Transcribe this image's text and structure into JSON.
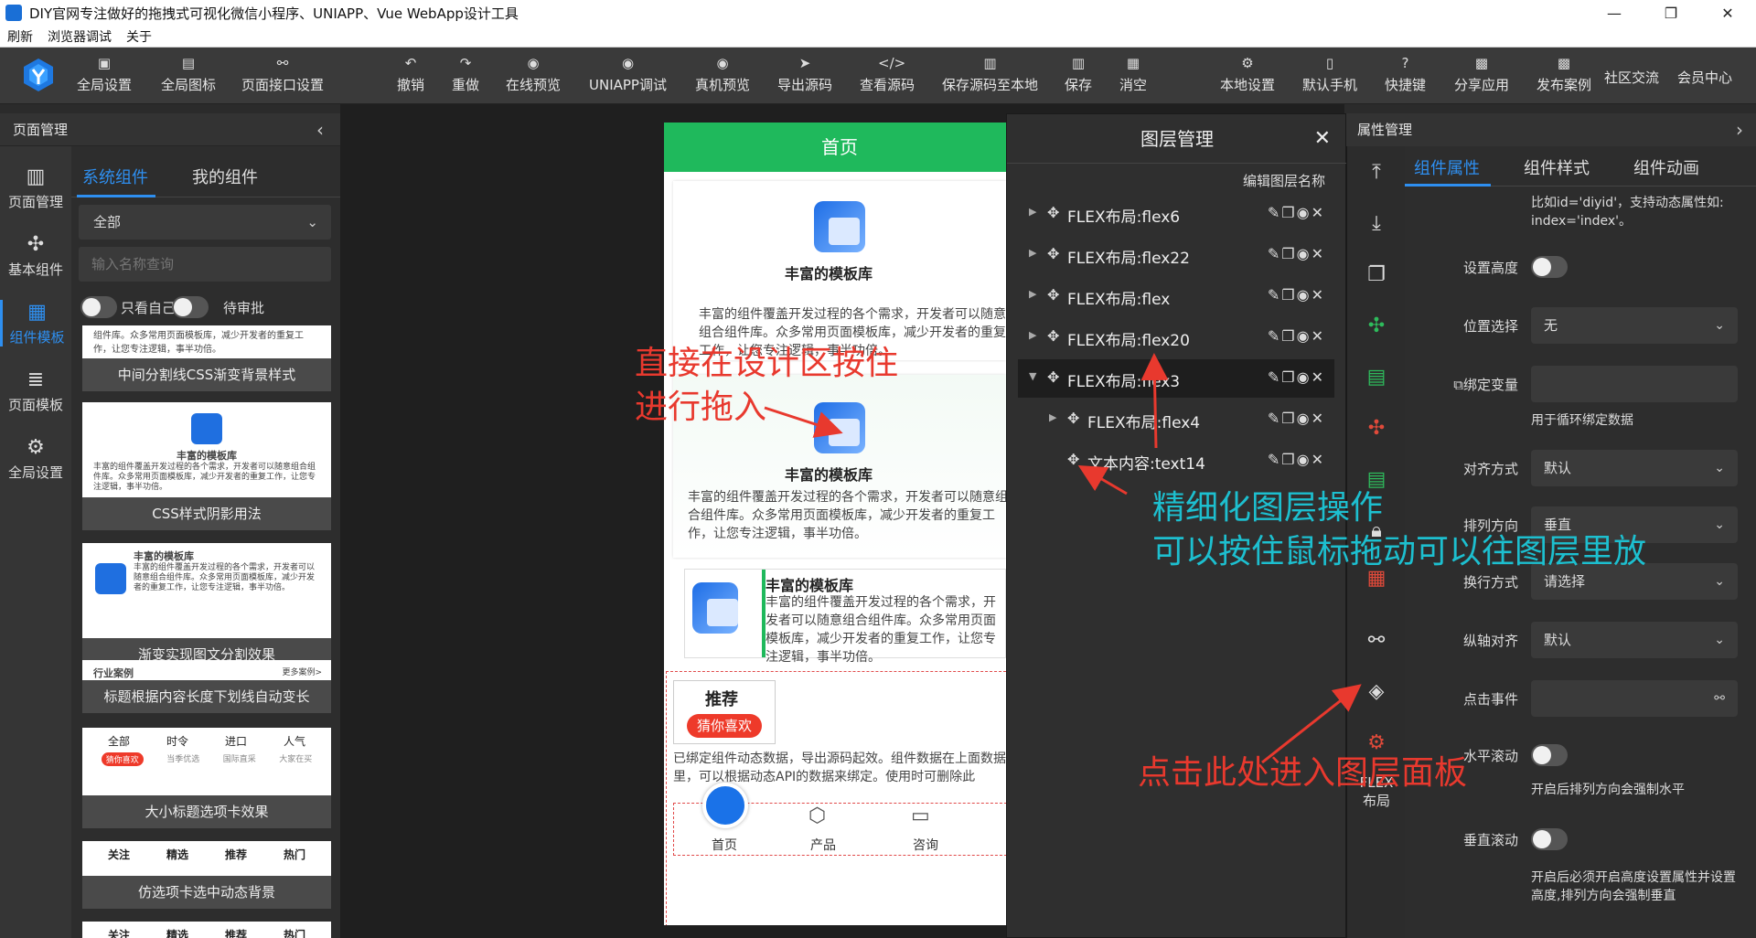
{
  "window": {
    "title": "DIY官网专注做好的拖拽式可视化微信小程序、UNIAPP、Vue WebApp设计工具",
    "minimize": "—",
    "maximize": "❐",
    "close": "✕"
  },
  "menu": [
    "刷新",
    "浏览器调试",
    "关于"
  ],
  "toolbar": {
    "global_settings": "全局设置",
    "global_icons": "全局图标",
    "page_api_settings": "页面接口设置",
    "undo": "撤销",
    "redo": "重做",
    "online_preview": "在线预览",
    "uniapp_debug": "UNIAPP调试",
    "device_preview": "真机预览",
    "export_source": "导出源码",
    "view_source": "查看源码",
    "save_source_local": "保存源码至本地",
    "save": "保存",
    "clear": "消空",
    "local_settings": "本地设置",
    "default_phone": "默认手机",
    "shortcuts": "快捷键",
    "share_app": "分享应用",
    "publish_case": "发布案例",
    "community": "社区交流",
    "member_center": "会员中心"
  },
  "left_panel": {
    "header": "页面管理",
    "nav": [
      "页面管理",
      "基本组件",
      "组件模板",
      "页面模板",
      "全局设置"
    ],
    "tabs": [
      "系统组件",
      "我的组件"
    ],
    "category": "全部",
    "search_placeholder": "输入名称查询",
    "toggle_self": "只看自己",
    "toggle_pending": "待审批",
    "cards": [
      {
        "caption": "中间分割线CSS渐变背景样式",
        "preview": "组件库。众多常用页面模板库，减少开发者的重复工作，让您专注逻辑，事半功倍。"
      },
      {
        "caption": "CSS样式阴影用法",
        "title": "丰富的模板库",
        "preview": "丰富的组件覆盖开发过程的各个需求，开发者可以随意组合组件库。众多常用页面模板库，减少开发者的重复工作，让您专注逻辑，事半功倍。"
      },
      {
        "caption": "渐变实现图文分割效果",
        "title": "丰富的模板库",
        "preview": "丰富的组件覆盖开发过程的各个需求，开发者可以随意组合组件库。众多常用页面模板库，减少开发者的重复工作，让您专注逻辑，事半功倍。"
      },
      {
        "caption": "标题根据内容长度下划线自动变长",
        "title": "行业案例",
        "more": "更多案例>"
      },
      {
        "caption": "大小标题选项卡效果",
        "tabs": [
          "全部",
          "时令",
          "进口",
          "人气"
        ],
        "subs": [
          "猜你喜欢",
          "当季优选",
          "国际直采",
          "大家在买"
        ]
      },
      {
        "caption": "仿选项卡选中动态背景",
        "tabs": [
          "关注",
          "精选",
          "推荐",
          "热门"
        ]
      },
      {
        "tabs": [
          "关注",
          "精选",
          "推荐",
          "热门"
        ]
      }
    ]
  },
  "phone": {
    "header": "首页",
    "block_title": "丰富的模板库",
    "block_text": "丰富的组件覆盖开发过程的各个需求，开发者可以随意组合组件库。众多常用页面模板库，减少开发者的重复工作，让您专注逻辑，事半功倍。",
    "block1_text": "丰富的组件覆盖开发过程的各个需求，开发者可以随意组合组件库。众多常用页面模板库，减少开发者的重复工作，让您专注逻辑，事半功倍。",
    "block3_text": "丰富的组件覆盖开发过程的各个需求，开发者可以随意组合组件库。众多常用页面模板库，减少开发者的重复工作，让您专注逻辑，事半功倍。",
    "recommend": "推荐",
    "guess": "猜你喜欢",
    "bound_note": "已绑定组件动态数据，导出源码起效。组件数据在上面数据里，可以根据动态API的数据来绑定。使用时可删除此",
    "tabbar": [
      "首页",
      "产品",
      "咨询"
    ]
  },
  "layer_panel": {
    "title": "图层管理",
    "edit_name": "编辑图层名称",
    "rows": [
      {
        "name": "FLEX布局:flex6",
        "expanded": false,
        "depth": 0
      },
      {
        "name": "FLEX布局:flex22",
        "expanded": false,
        "depth": 0
      },
      {
        "name": "FLEX布局:flex",
        "expanded": false,
        "depth": 0
      },
      {
        "name": "FLEX布局:flex20",
        "expanded": false,
        "depth": 0
      },
      {
        "name": "FLEX布局:flex3",
        "expanded": true,
        "depth": 0,
        "selected": true
      },
      {
        "name": "FLEX布局:flex4",
        "expanded": false,
        "depth": 1
      },
      {
        "name": "文本内容:text14",
        "expanded": false,
        "depth": 1,
        "leaf": true
      }
    ]
  },
  "right_strip": {
    "flex_label": "FLEX布局"
  },
  "prop_panel": {
    "header": "属性管理",
    "tabs": [
      "组件属性",
      "组件样式",
      "组件动画"
    ],
    "top_help": "比如id='diyid'，支持动态属性如: index='index'。",
    "set_height": "设置高度",
    "position": "位置选择",
    "position_value": "无",
    "bind_var": "绑定变量",
    "bind_help": "用于循环绑定数据",
    "align": "对齐方式",
    "align_value": "默认",
    "direction": "排列方向",
    "direction_value": "垂直",
    "wrap": "换行方式",
    "wrap_value": "请选择",
    "cross_align": "纵轴对齐",
    "cross_align_value": "默认",
    "click_event": "点击事件",
    "hscroll": "水平滚动",
    "hscroll_help": "开启后排列方向会强制水平",
    "vscroll": "垂直滚动",
    "vscroll_help": "开启后必须开启高度设置属性并设置高度,排列方向会强制垂直"
  },
  "annotations": {
    "drag_design": "直接在设计区按住\n进行拖入",
    "layer_ops_1": "精细化图层操作",
    "layer_ops_2": "可以按住鼠标拖动可以往图层里放",
    "click_here": "点击此处进入图层面板"
  },
  "colors": {
    "accent": "#2e8ff0",
    "phone_header": "#1fb95c",
    "annotation_red": "#e8392e",
    "annotation_cyan": "#1dbfcf"
  }
}
